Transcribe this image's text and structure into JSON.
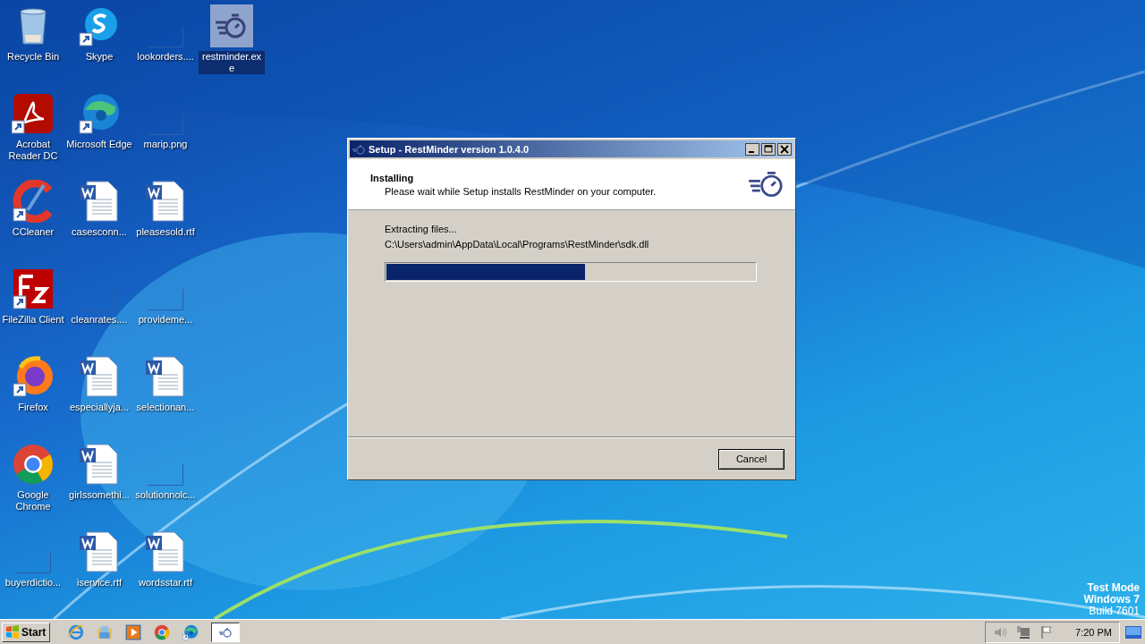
{
  "desktop": {
    "rows": [
      [
        {
          "label": "Recycle Bin",
          "kind": "recycle",
          "selected": false
        },
        {
          "label": "Skype",
          "kind": "skype",
          "selected": false
        },
        {
          "label": "lookorders....",
          "kind": "blank",
          "selected": false
        },
        {
          "label": "restminder.exe",
          "kind": "app",
          "selected": true
        }
      ],
      [
        {
          "label": "Acrobat Reader DC",
          "kind": "acrobat",
          "selected": false
        },
        {
          "label": "Microsoft Edge",
          "kind": "edge",
          "selected": false
        },
        {
          "label": "marip.png",
          "kind": "blank",
          "selected": false
        }
      ],
      [
        {
          "label": "CCleaner",
          "kind": "ccleaner",
          "selected": false
        },
        {
          "label": "casesconn...",
          "kind": "word",
          "selected": false
        },
        {
          "label": "pleasesold.rtf",
          "kind": "word",
          "selected": false
        }
      ],
      [
        {
          "label": "FileZilla Client",
          "kind": "filezilla",
          "selected": false
        },
        {
          "label": "cleanrates....",
          "kind": "blank",
          "selected": false
        },
        {
          "label": "provideme...",
          "kind": "blank",
          "selected": false
        }
      ],
      [
        {
          "label": "Firefox",
          "kind": "firefox",
          "selected": false
        },
        {
          "label": "especiallyja...",
          "kind": "word",
          "selected": false
        },
        {
          "label": "selectionan...",
          "kind": "word",
          "selected": false
        }
      ],
      [
        {
          "label": "Google Chrome",
          "kind": "chrome",
          "selected": false
        },
        {
          "label": "girlssomethi...",
          "kind": "word",
          "selected": false
        },
        {
          "label": "solutionnolc...",
          "kind": "blank",
          "selected": false
        }
      ],
      [
        {
          "label": "buyerdictio...",
          "kind": "blank",
          "selected": false
        },
        {
          "label": "iservice.rtf",
          "kind": "word",
          "selected": false
        },
        {
          "label": "wordsstar.rtf",
          "kind": "word",
          "selected": false
        }
      ]
    ],
    "os_info": [
      "Test Mode",
      "Windows 7",
      "Build 7601"
    ]
  },
  "window": {
    "title": "Setup - RestMinder version 1.0.4.0",
    "heading": "Installing",
    "subheading": "Please wait while Setup installs RestMinder on your computer.",
    "status": "Extracting files...",
    "file": "C:\\Users\\admin\\AppData\\Local\\Programs\\RestMinder\\sdk.dll",
    "progress": {
      "level": 0.54
    },
    "buttons": [
      "Cancel"
    ]
  },
  "taskbar": {
    "start": "Start",
    "quick_launch": [
      {
        "kind": "ie"
      },
      {
        "kind": "explorer"
      },
      {
        "kind": "media"
      },
      {
        "kind": "chrome"
      },
      {
        "kind": "edge"
      }
    ],
    "tasks": [
      {
        "kind": "stopwatch",
        "selected": true
      }
    ],
    "clock": "7:20 PM"
  }
}
